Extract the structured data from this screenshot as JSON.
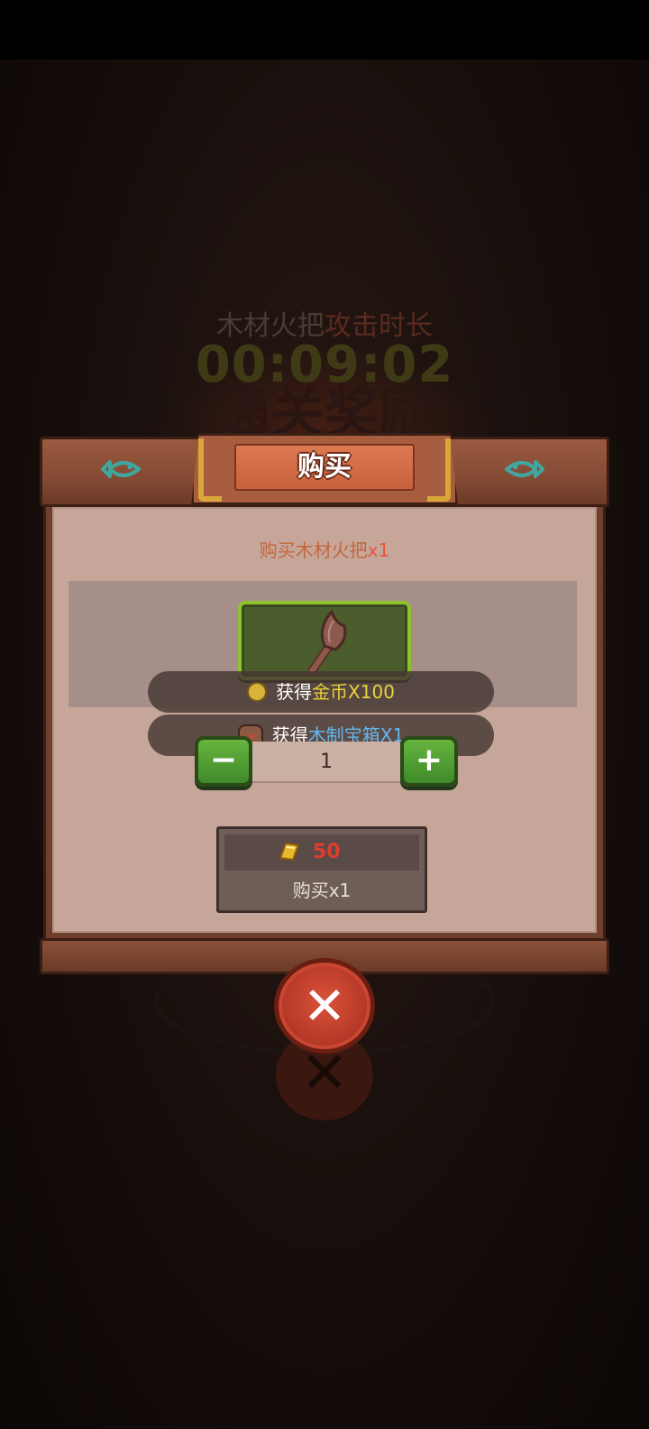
{
  "background": {
    "timer_label_prefix": "木材火把",
    "timer_label_suffix": "攻击时长",
    "timer_value": "00:09:02",
    "shadow_text": "通关奖励"
  },
  "dialog": {
    "title": "购买",
    "description_prefix": "购买木材火把",
    "description_qty": "x1",
    "item_icon": "wooden-torch-icon",
    "rewards": [
      {
        "icon": "coin-icon",
        "prefix": "获得",
        "highlight": "金币X100",
        "highlight_color": "#e9d23a"
      },
      {
        "icon": "chest-icon",
        "prefix": "获得",
        "highlight": "木制宝箱X1",
        "highlight_color": "#62b7ef"
      }
    ],
    "quantity": "1",
    "price": "50",
    "buy_label": "购买x1",
    "decor_icon": "fish-icon",
    "close_icon": "close-icon"
  },
  "colors": {
    "accent_green": "#8fc22f",
    "price_red": "#e23b30",
    "title_orange": "#dd7a52"
  }
}
